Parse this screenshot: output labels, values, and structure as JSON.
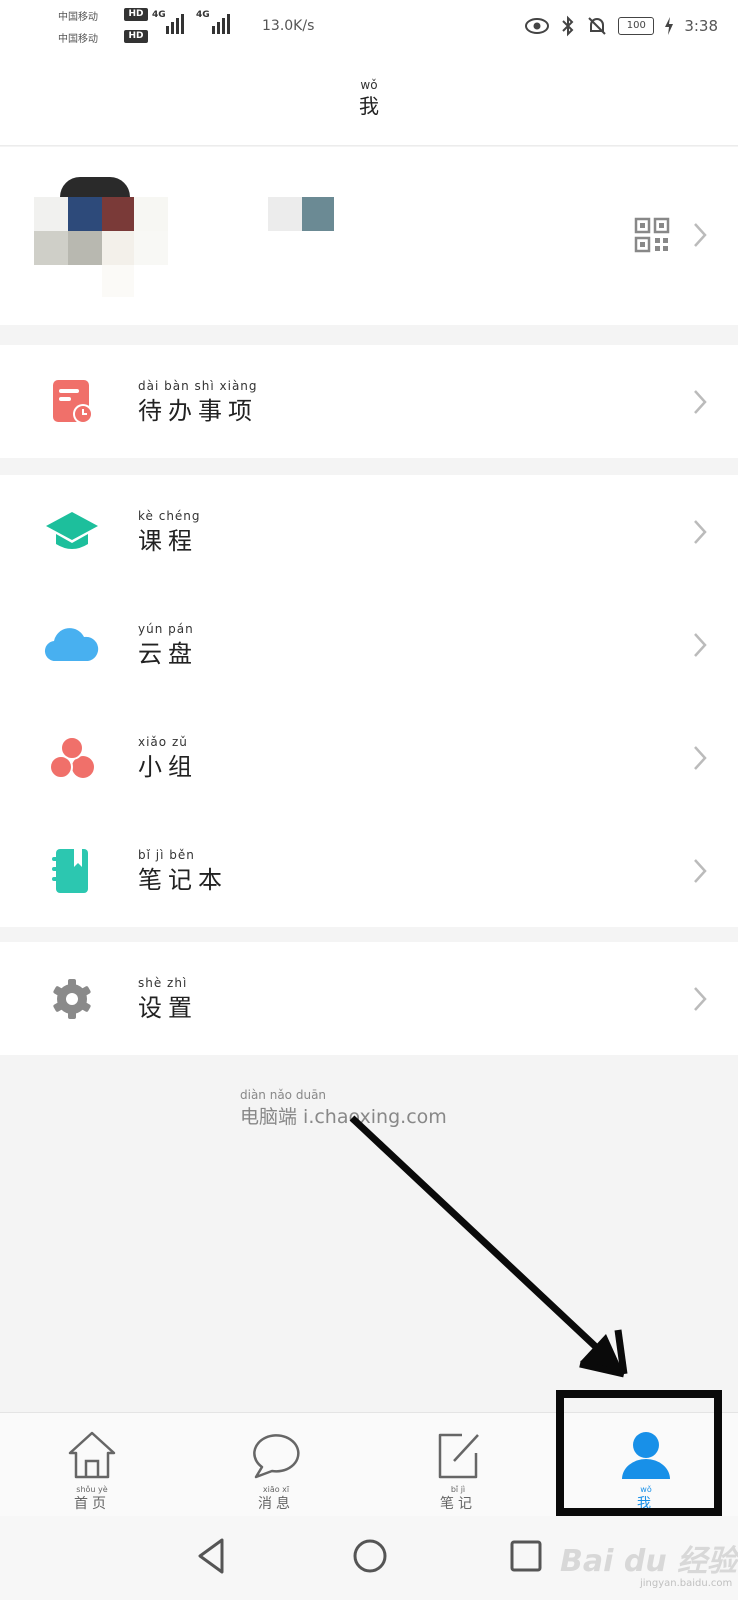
{
  "status_bar": {
    "carrier1": "中国移动",
    "carrier2": "中国移动",
    "hd1": "HD",
    "hd2": "HD",
    "net1": "4G",
    "net2": "4G",
    "speed": "13.0K/s",
    "battery": "100",
    "time": "3:38"
  },
  "header": {
    "pinyin": "wǒ",
    "title": "我"
  },
  "profile": {
    "qr_icon": "qr-code-icon",
    "chevron_icon": "chevron-right-icon"
  },
  "menu": {
    "todo": {
      "pinyin": "dài  bàn  shì  xiàng",
      "label": "待办事项",
      "icon": "todo-document-clock-icon",
      "color": "#f0706a"
    },
    "courses": {
      "pinyin": "kè  chéng",
      "label": "课程",
      "icon": "graduation-cap-icon",
      "color": "#1dbf9c"
    },
    "cloud": {
      "pinyin": "yún  pán",
      "label": "云盘",
      "icon": "cloud-icon",
      "color": "#48b0f0"
    },
    "group": {
      "pinyin": "xiǎo  zǔ",
      "label": "小组",
      "icon": "group-circles-icon",
      "color": "#f0706a"
    },
    "notebook": {
      "pinyin": "bǐ    jì   běn",
      "label": "笔记本",
      "icon": "notebook-icon",
      "color": "#2cc7b0"
    },
    "settings": {
      "pinyin": "shè  zhì",
      "label": "设置",
      "icon": "gear-icon",
      "color": "#8a8a8a"
    }
  },
  "site": {
    "pinyin": "diàn  nǎo  duān",
    "text": "电脑端 i.chaoxing.com"
  },
  "tabs": [
    {
      "pinyin": "shǒu  yè",
      "label": "首页",
      "icon": "home-icon"
    },
    {
      "pinyin": "xiāo  xī",
      "label": "消息",
      "icon": "chat-bubble-icon"
    },
    {
      "pinyin": "bǐ   jì",
      "label": "笔记",
      "icon": "edit-note-icon"
    },
    {
      "pinyin": "wǒ",
      "label": "我",
      "icon": "user-icon"
    }
  ],
  "colors": {
    "accent": "#1890e8",
    "annotation": "#0a0a0a"
  },
  "watermark": {
    "text": "Bai du 经验",
    "sub": "jingyan.baidu.com"
  }
}
